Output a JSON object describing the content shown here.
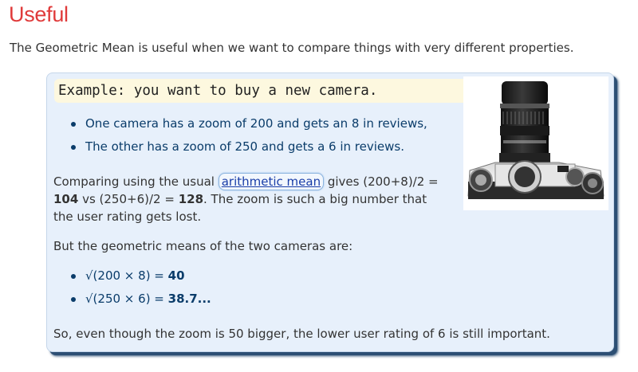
{
  "heading": "Useful",
  "intro": "The Geometric Mean is useful when we want to compare things with very different properties.",
  "example": {
    "title": "Example: you want to buy a new camera.",
    "bullets": [
      "One camera has a zoom of 200 and gets an 8 in reviews,",
      "The other has a zoom of 250 and gets a 6 in reviews."
    ],
    "compare": {
      "pre": "Comparing using the usual ",
      "link": "arithmetic mean",
      "mid1": " gives (200+8)/2 = ",
      "val1": "104",
      "mid2": " vs (250+6)/2 = ",
      "val2": "128",
      "post": ". The zoom is such a big number that the user rating gets lost."
    },
    "geo_intro": "But the geometric means of the two cameras are:",
    "geo_results": [
      {
        "expr": "√(200 × 8) = ",
        "value": "40"
      },
      {
        "expr": "√(250 × 6) = ",
        "value": "38.7..."
      }
    ],
    "conclusion": "So, even though the zoom is 50 bigger, the lower user rating of 6 is still important.",
    "image_icon": "camera-photo"
  }
}
